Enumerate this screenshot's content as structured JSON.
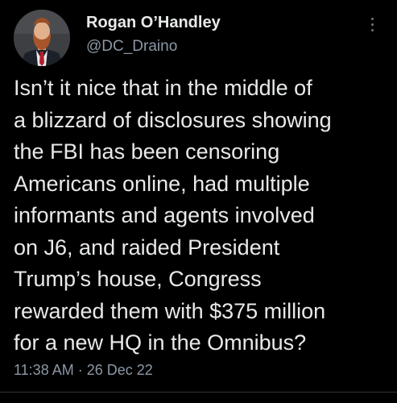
{
  "author": {
    "display_name": "Rogan O’Handley",
    "handle": "@DC_Draino"
  },
  "tweet": {
    "lines": [
      "Isn’t it nice that in the middle of",
      "a blizzard of disclosures showing",
      "the FBI has been censoring",
      "Americans online, had multiple",
      "informants and agents involved",
      "on J6, and raided President",
      "Trump’s house, Congress",
      "rewarded them with $375 million",
      "for a new HQ in the Omnibus?"
    ],
    "time": "11:38 AM",
    "separator": "·",
    "date": "26 Dec 22"
  },
  "icons": {
    "avatar": "avatar",
    "more": "more-options-icon"
  },
  "colors": {
    "background": "#000000",
    "text": "#e7e9ea",
    "secondary_text": "#8b98a5"
  }
}
